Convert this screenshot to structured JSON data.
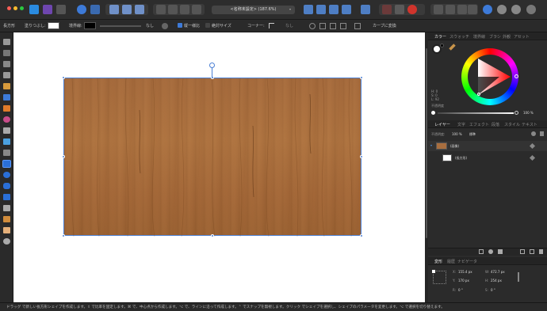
{
  "document": {
    "title": "<名称未設定> (187.6%)"
  },
  "context_toolbar": {
    "shape_label": "長方形",
    "fill_label": "塗りつぶし:",
    "stroke_label": "境界線:",
    "stroke_none": "なし",
    "snap_label": "縦一様比",
    "absolute_size_label": "絶対サイズ",
    "corner_label": "コーナー:",
    "corner_value": "なし",
    "convert_button": "カーブに変換",
    "fill_color": "#ffffff",
    "stroke_color": "#000000"
  },
  "color_panel": {
    "tabs": [
      "カラー",
      "スウォッチ",
      "境界線",
      "ブラシ",
      "外観",
      "アセット"
    ],
    "h": "H: 0",
    "s": "S: 0",
    "l": "L: 92",
    "opacity_label": "不透明度",
    "opacity_value": "100 %"
  },
  "layers_panel": {
    "tabs": [
      "レイヤー",
      "文字",
      "エフェクト",
      "段落",
      "スタイル",
      "テキスト"
    ],
    "opacity_label": "不透明度:",
    "opacity_value": "100 %",
    "blend_mode": "標準",
    "layers": [
      {
        "name": "(画像)"
      },
      {
        "name": "(長方形)"
      }
    ]
  },
  "transform_panel": {
    "tabs": [
      "変形",
      "履歴",
      "ナビゲータ"
    ],
    "x_label": "X:",
    "x_value": "155.4 px",
    "w_label": "W:",
    "w_value": "472.7 px",
    "y_label": "Y:",
    "y_value": "170 px",
    "h_label": "H:",
    "h_value": "254 px",
    "r_label": "R:",
    "r_value": "0 °",
    "s_label": "S:",
    "s_value": "0 °"
  },
  "status": {
    "text": "ドラッグ で新しい長方形シェイプを作成します。⇧ で比率を固定します。⌘ で、中心点から作成します。⌥ で、ラインに沿って作成します。⌃ でスナップを無視します。クリック でシェイプを選択し、シェイプのパラメータを変更します。⌥ で選択を切り替えます。"
  },
  "colors": {
    "accent": "#4a7fd4",
    "wood": "#a86e3f"
  }
}
